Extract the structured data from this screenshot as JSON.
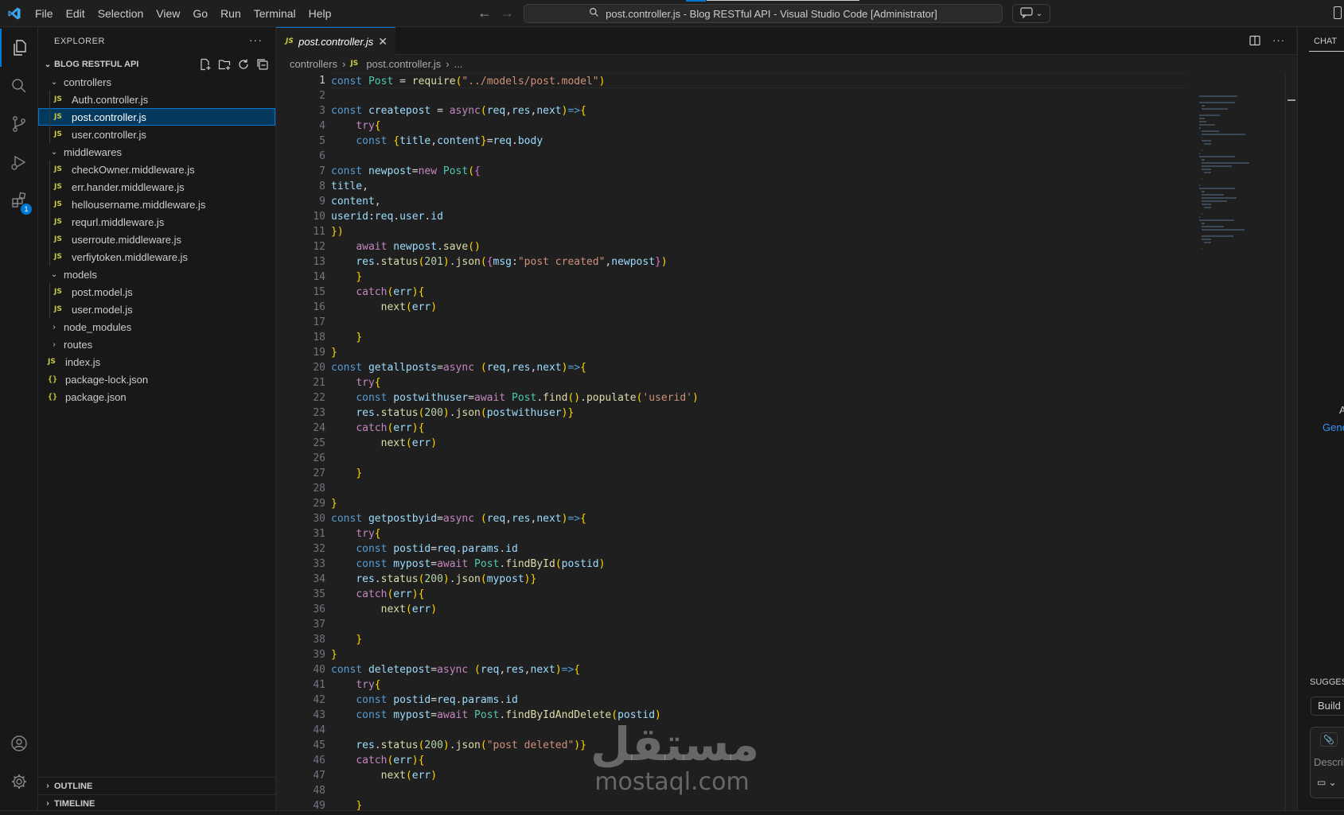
{
  "titlebar": {
    "menu": [
      "File",
      "Edit",
      "Selection",
      "View",
      "Go",
      "Run",
      "Terminal",
      "Help"
    ],
    "command_center": "post.controller.js - Blog RESTful API - Visual Studio Code [Administrator]"
  },
  "activity": {
    "extensions_badge": "1"
  },
  "sidebar": {
    "title": "EXPLORER",
    "more": "···",
    "project": "BLOG RESTFUL API",
    "tree": [
      {
        "label": "controllers",
        "kind": "folder-open",
        "depth": 1
      },
      {
        "label": "Auth.controller.js",
        "kind": "js",
        "depth": 2
      },
      {
        "label": "post.controller.js",
        "kind": "js",
        "depth": 2,
        "selected": true
      },
      {
        "label": "user.controller.js",
        "kind": "js",
        "depth": 2
      },
      {
        "label": "middlewares",
        "kind": "folder-open",
        "depth": 1
      },
      {
        "label": "checkOwner.middleware.js",
        "kind": "js",
        "depth": 2
      },
      {
        "label": "err.hander.middleware.js",
        "kind": "js",
        "depth": 2
      },
      {
        "label": "hellousername.middleware.js",
        "kind": "js",
        "depth": 2
      },
      {
        "label": "requrl.middleware.js",
        "kind": "js",
        "depth": 2
      },
      {
        "label": "userroute.middleware.js",
        "kind": "js",
        "depth": 2
      },
      {
        "label": "verfiytoken.middleware.js",
        "kind": "js",
        "depth": 2
      },
      {
        "label": "models",
        "kind": "folder-open",
        "depth": 1
      },
      {
        "label": "post.model.js",
        "kind": "js",
        "depth": 2
      },
      {
        "label": "user.model.js",
        "kind": "js",
        "depth": 2
      },
      {
        "label": "node_modules",
        "kind": "folder-closed",
        "depth": 1
      },
      {
        "label": "routes",
        "kind": "folder-closed",
        "depth": 1
      },
      {
        "label": "index.js",
        "kind": "js",
        "depth": 1
      },
      {
        "label": "package-lock.json",
        "kind": "json",
        "depth": 1
      },
      {
        "label": "package.json",
        "kind": "json",
        "depth": 1
      }
    ],
    "outline": "OUTLINE",
    "timeline": "TIMELINE"
  },
  "editor": {
    "tab": {
      "label": "post.controller.js",
      "icon": "JS"
    },
    "breadcrumb": [
      "controllers",
      "post.controller.js",
      "..."
    ],
    "current_line": 1,
    "code": [
      "const Post = require(\"../models/post.model\")",
      "",
      "const createpost = async(req,res,next)=>{",
      "    try{",
      "    const {title,content}=req.body",
      "",
      "const newpost=new Post({",
      "title,",
      "content,",
      "userid:req.user.id",
      "})",
      "    await newpost.save()",
      "    res.status(201).json({msg:\"post created\",newpost})",
      "    }",
      "    catch(err){",
      "        next(err)",
      "",
      "    }",
      "}",
      "const getallposts=async (req,res,next)=>{",
      "    try{",
      "    const postwithuser=await Post.find().populate('userid')",
      "    res.status(200).json(postwithuser)}",
      "    catch(err){",
      "        next(err)",
      "",
      "    }",
      "",
      "}",
      "const getpostbyid=async (req,res,next)=>{",
      "    try{",
      "    const postid=req.params.id",
      "    const mypost=await Post.findById(postid)",
      "    res.status(200).json(mypost)}",
      "    catch(err){",
      "        next(err)",
      "",
      "    }",
      "}",
      "const deletepost=async (req,res,next)=>{",
      "    try{",
      "    const postid=req.params.id",
      "    const mypost=await Post.findByIdAndDelete(postid)",
      "",
      "    res.status(200).json(\"post deleted\")}",
      "    catch(err){",
      "        next(err)",
      "",
      "    }"
    ]
  },
  "chat": {
    "title": "CHAT",
    "partial_a": "A",
    "partial_link": "Gene",
    "suggestions_label": "SUGGES",
    "build_label": "Build",
    "input_placeholder": "Describ"
  },
  "watermark": {
    "arabic": "مستقل",
    "latin": "mostaql.com"
  },
  "colors": {
    "accent": "#0078d4",
    "background": "#1f1f1f",
    "sidebar": "#181818"
  }
}
